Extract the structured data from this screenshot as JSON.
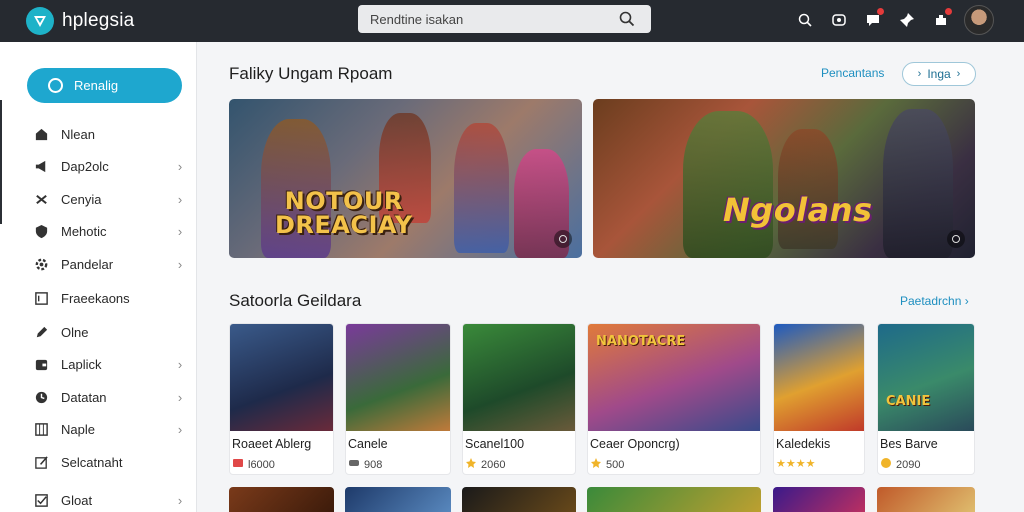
{
  "app": {
    "name": "hplegsia"
  },
  "search": {
    "value": "Rendtine isakan"
  },
  "topbar": {
    "icons": [
      "search-icon",
      "controller-icon",
      "chat-icon",
      "pin-icon",
      "puzzle-icon"
    ],
    "badge_color": "#e53b3b"
  },
  "sidebar": {
    "primary": {
      "label": "Renalig"
    },
    "items": [
      {
        "label": "Nlean",
        "icon": "home-icon",
        "chevron": false
      },
      {
        "label": "Dap2olc",
        "icon": "megaphone-icon",
        "chevron": true
      },
      {
        "label": "Cenyia",
        "icon": "gamepad-icon",
        "chevron": true
      },
      {
        "label": "Mehotic",
        "icon": "shield-icon",
        "chevron": true
      },
      {
        "label": "Pandelar",
        "icon": "gear-icon",
        "chevron": true
      },
      {
        "label": "Fraeekaons",
        "icon": "list-icon",
        "chevron": false
      },
      {
        "label": "Olne",
        "icon": "pen-icon",
        "chevron": false
      },
      {
        "label": "Laplick",
        "icon": "wallet-icon",
        "chevron": true
      },
      {
        "label": "Datatan",
        "icon": "clock-icon",
        "chevron": true
      },
      {
        "label": "Naple",
        "icon": "grid-icon",
        "chevron": true
      },
      {
        "label": "Selcatnaht",
        "icon": "edit-icon",
        "chevron": false
      },
      {
        "label": "Gloat",
        "icon": "checkbox-icon",
        "chevron": true
      }
    ],
    "accent": "#1ea7cf"
  },
  "featured": {
    "title": "Faliky Ungam Rpoam",
    "link": "Pencantans",
    "pill": "Inga",
    "banners": [
      {
        "title_line1": "NOTOUR",
        "title_line2": "DREACIAY"
      },
      {
        "title_line1": "Ngolans"
      }
    ]
  },
  "section2": {
    "title": "Satoorla Geildara",
    "link": "Paetadrchn",
    "games": [
      {
        "name": "Roaeet Ablerg",
        "meta": "l6000",
        "meta_icon": "ticket-icon",
        "meta_color": "#e04848",
        "art_text": ""
      },
      {
        "name": "Canele",
        "meta": "908",
        "meta_icon": "controller-icon",
        "meta_color": "#666666",
        "art_text": ""
      },
      {
        "name": "Scanel100",
        "meta": "2060",
        "meta_icon": "star-icon",
        "meta_color": "#f0b429",
        "art_text": ""
      },
      {
        "name": "Ceaer Oponcrg)",
        "meta": "500",
        "meta_icon": "star-icon",
        "meta_color": "#f0b429",
        "art_text": "NANOTACRE"
      },
      {
        "name": "Kaledekis",
        "meta": "★★★★",
        "meta_icon": "rating-icon",
        "meta_color": "#f0b429",
        "art_text": ""
      },
      {
        "name": "Bes Barve",
        "meta": "2090",
        "meta_icon": "coin-icon",
        "meta_color": "#f0b429",
        "art_text": "CANIE"
      }
    ]
  }
}
